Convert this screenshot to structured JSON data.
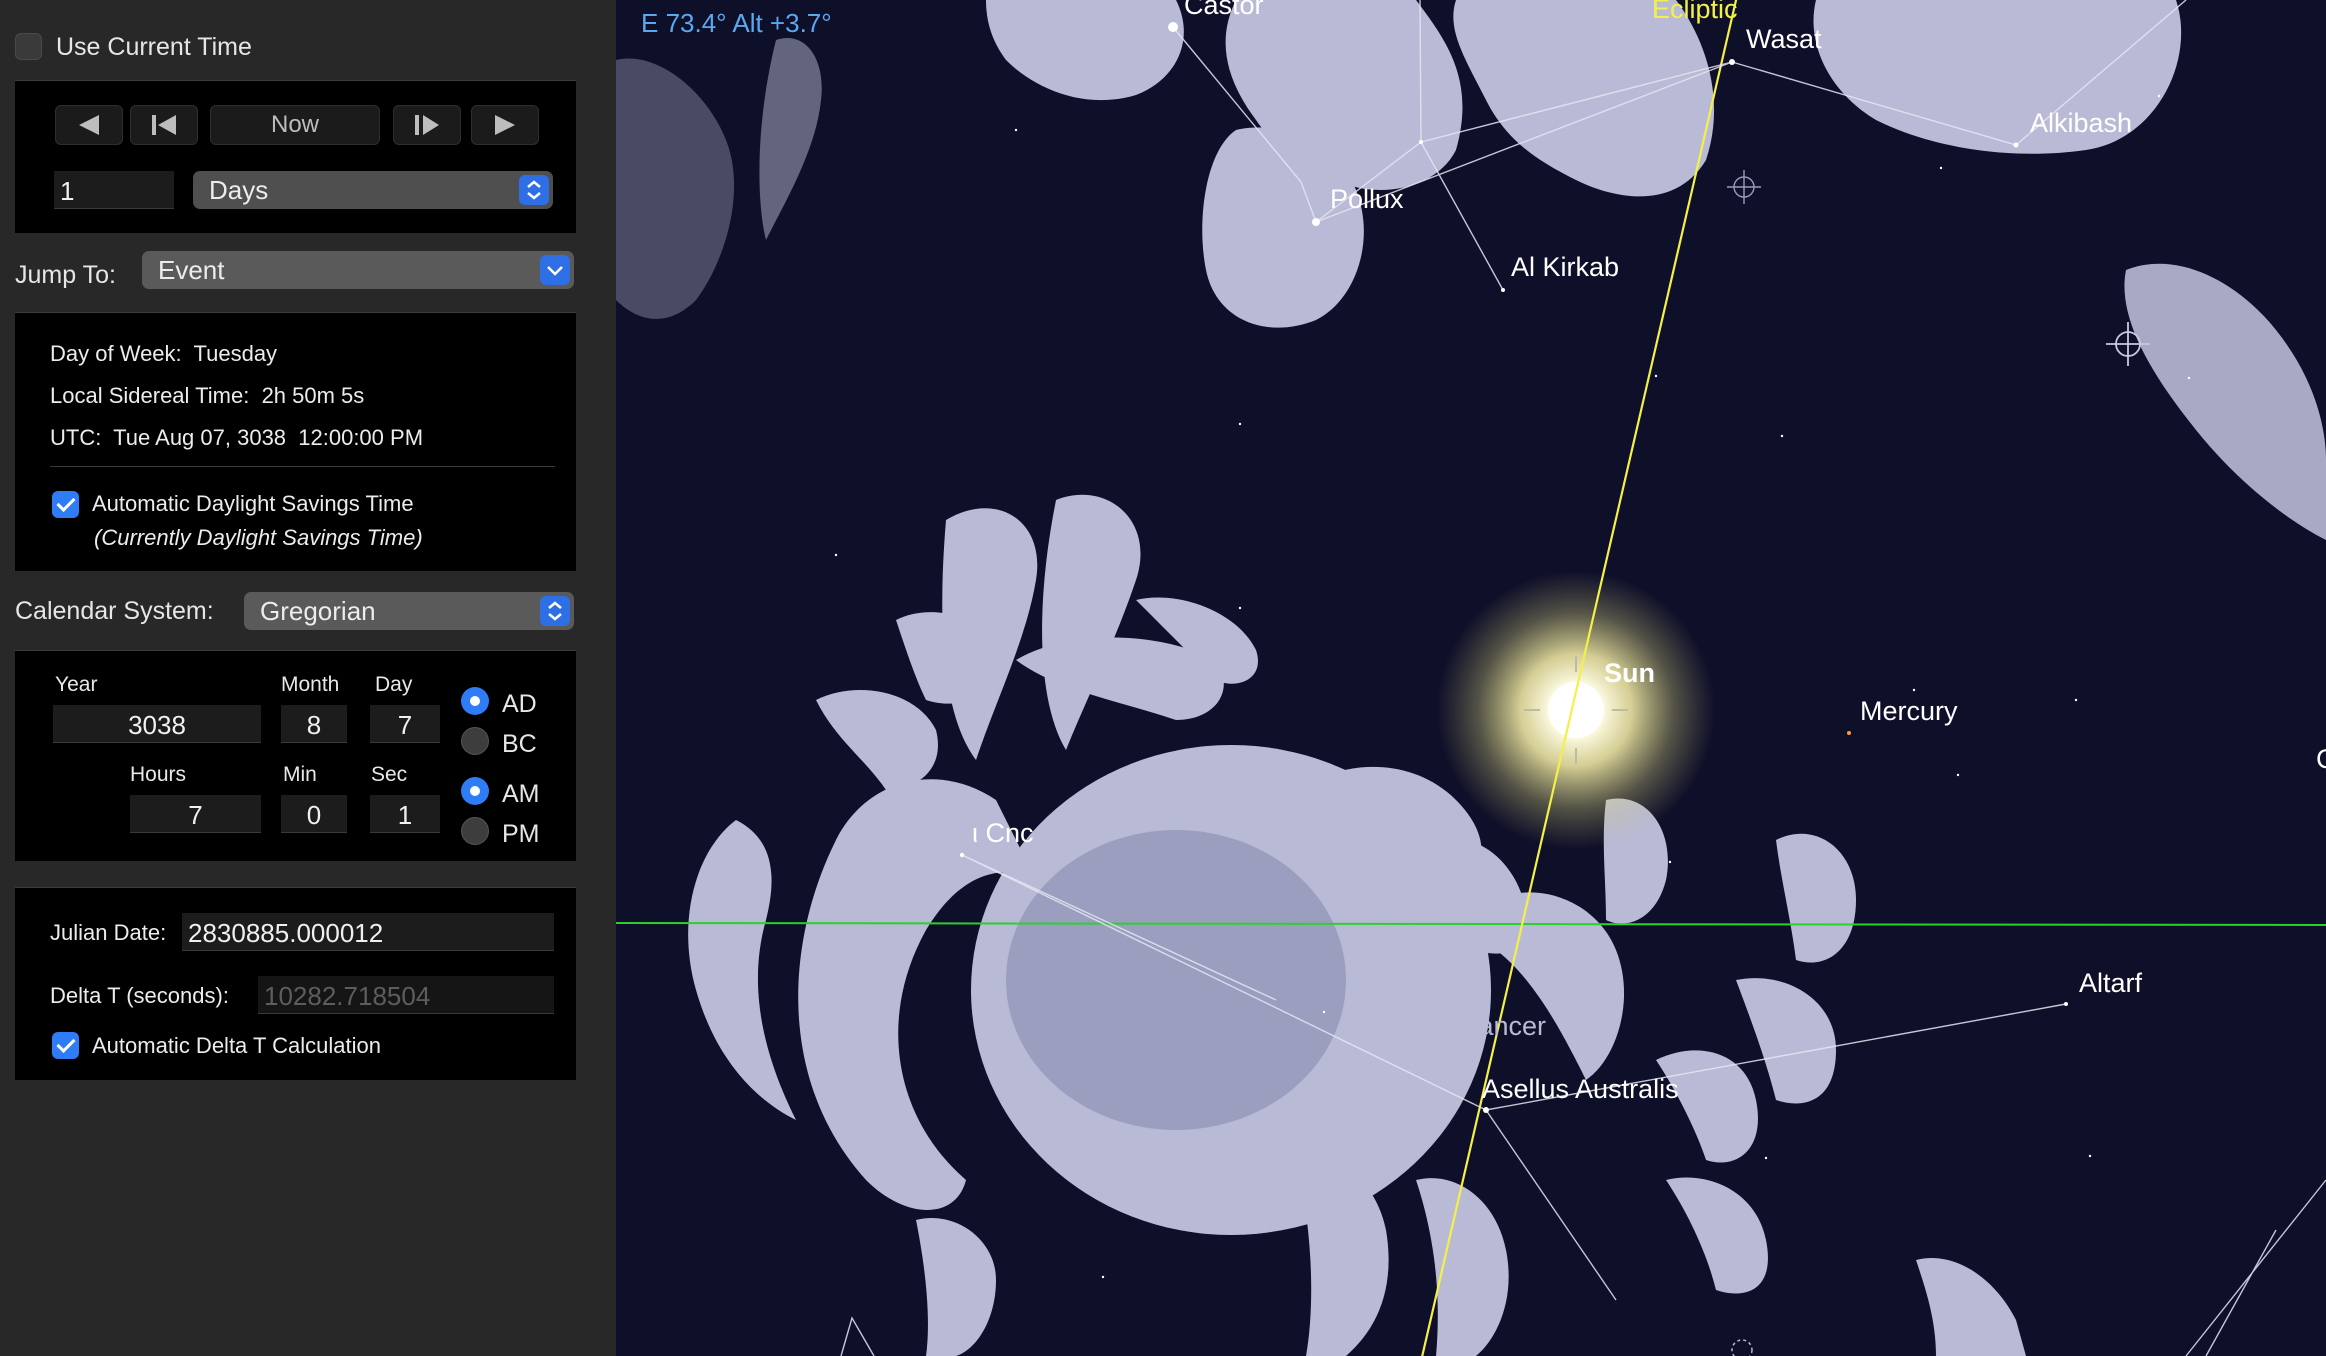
{
  "panel": {
    "use_current_time": {
      "label": "Use Current Time",
      "checked": false
    },
    "time_controls": {
      "now_label": "Now",
      "step_value": "1",
      "step_unit": "Days"
    },
    "jump_to": {
      "label": "Jump To:",
      "value": "Event"
    },
    "info": {
      "day_of_week_label": "Day of Week:",
      "day_of_week": "Tuesday",
      "sidereal_label": "Local Sidereal Time:",
      "sidereal": "2h 50m 5s",
      "utc_label": "UTC:",
      "utc": "Tue Aug 07, 3038  12:00:00 PM",
      "dst_label": "Automatic Daylight Savings Time",
      "dst_checked": true,
      "dst_note": "(Currently Daylight Savings Time)"
    },
    "calendar": {
      "label": "Calendar System:",
      "value": "Gregorian"
    },
    "date": {
      "year_label": "Year",
      "year": "3038",
      "month_label": "Month",
      "month": "8",
      "day_label": "Day",
      "day": "7",
      "hours_label": "Hours",
      "hours": "7",
      "min_label": "Min",
      "min": "0",
      "sec_label": "Sec",
      "sec": "1",
      "era": [
        "AD",
        "BC"
      ],
      "era_selected": "AD",
      "ampm": [
        "AM",
        "PM"
      ],
      "ampm_selected": "AM"
    },
    "julian": {
      "label": "Julian Date:",
      "value": "2830885.000012",
      "delta_label": "Delta T (seconds):",
      "delta_value": "10282.718504",
      "auto_delta_label": "Automatic Delta T Calculation",
      "auto_delta_checked": true
    }
  },
  "sky": {
    "coords": "E 73.4° Alt +3.7°",
    "ecliptic_label": "Ecliptic",
    "labels": {
      "castor": "Castor",
      "wasat": "Wasat",
      "alkibash": "Alkibash",
      "pollux": "Pollux",
      "al_kirkab": "Al Kirkab",
      "sun": "Sun",
      "mercury": "Mercury",
      "iota_cnc": "ι Cnc",
      "altarf": "Altarf",
      "cancer": "Cancer",
      "asellus_australis": "Asellus Australis",
      "edge": "C"
    },
    "colors": {
      "background": "#0e0f29",
      "ecliptic": "#f4f04a",
      "horizon": "#2bd12b",
      "coords_text": "#5aa8ee",
      "artwork": "#c9cbe6"
    }
  }
}
